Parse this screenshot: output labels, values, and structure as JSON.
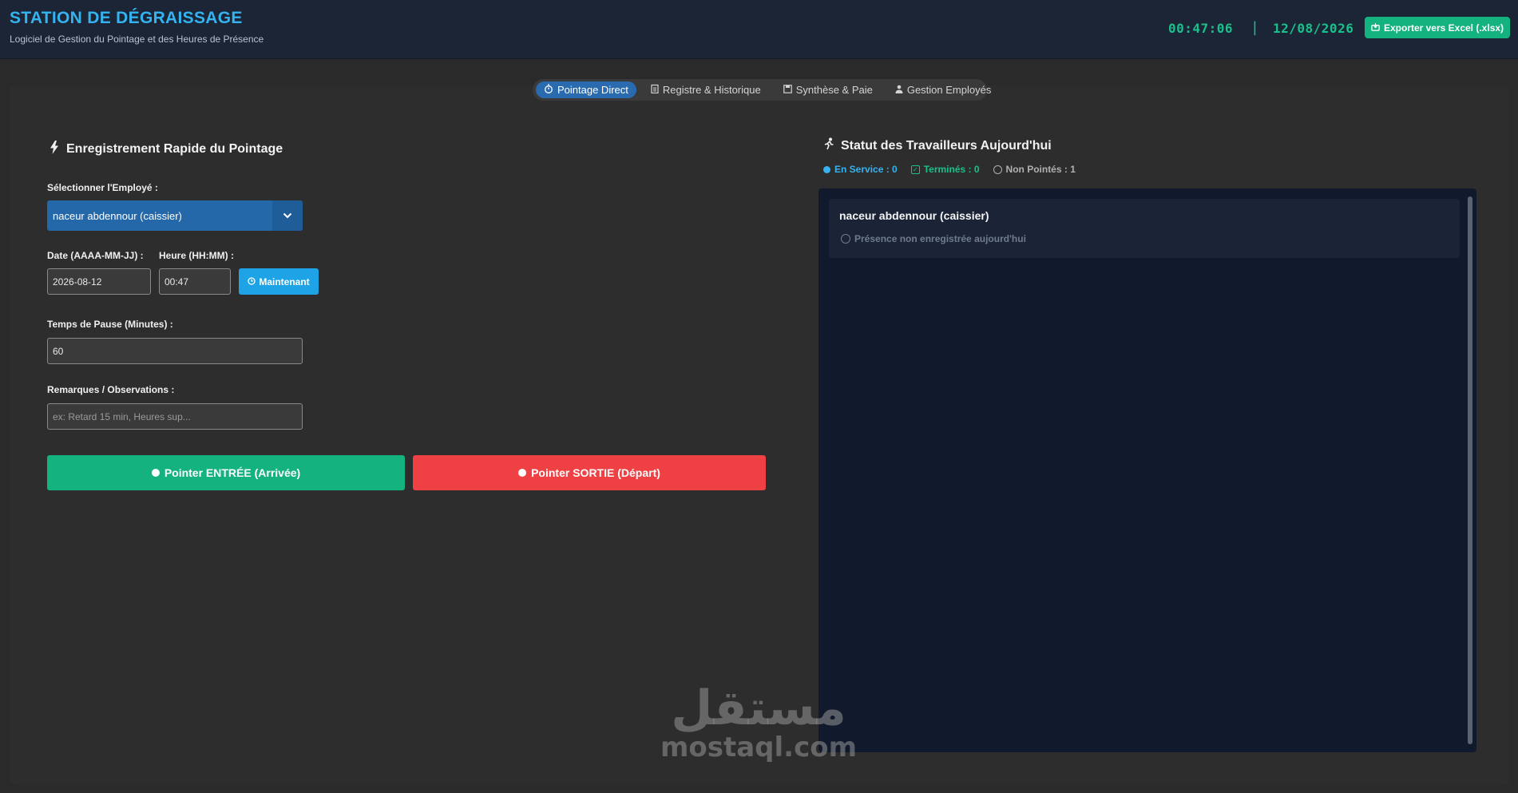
{
  "header": {
    "title": "STATION DE DÉGRAISSAGE",
    "subtitle": "Logiciel de Gestion du Pointage et des Heures de Présence",
    "time": "00:47:06",
    "separator": "|",
    "date": "12/08/2026",
    "export_label": "Exporter vers Excel (.xlsx)"
  },
  "tabs": [
    {
      "label": "Pointage Direct",
      "icon": "stopwatch-icon",
      "active": true
    },
    {
      "label": "Registre & Historique",
      "icon": "clipboard-icon",
      "active": false
    },
    {
      "label": "Synthèse & Paie",
      "icon": "floppy-icon",
      "active": false
    },
    {
      "label": "Gestion Employés",
      "icon": "user-icon",
      "active": false
    }
  ],
  "form": {
    "title": "Enregistrement Rapide du Pointage",
    "employee_label": "Sélectionner l'Employé :",
    "employee_value": "naceur abdennour (caissier)",
    "date_label": "Date (AAAA-MM-JJ) :",
    "date_value": "2026-08-12",
    "hour_label": "Heure (HH:MM) :",
    "hour_value": "00:47",
    "now_label": "Maintenant",
    "pause_label": "Temps de Pause (Minutes) :",
    "pause_value": "60",
    "remarks_label": "Remarques / Observations :",
    "remarks_placeholder": "ex: Retard 15 min, Heures sup...",
    "btn_in": "Pointer ENTRÉE (Arrivée)",
    "btn_out": "Pointer SORTIE (Départ)"
  },
  "status": {
    "title": "Statut des Travailleurs Aujourd'hui",
    "in_service": "En Service : 0",
    "finished": "Terminés : 0",
    "not_clocked": "Non Pointés : 1",
    "workers": [
      {
        "name": "naceur abdennour (caissier)",
        "status": "Présence non enregistrée aujourd'hui"
      }
    ]
  },
  "watermark": {
    "arabic": "مستقل",
    "latin": "mostaql.com"
  },
  "colors": {
    "accent_blue": "#35b3f0",
    "accent_green": "#13b27f",
    "danger_red": "#ef4044",
    "header_bg": "#1b2535",
    "panel_bg": "#111a2c"
  }
}
